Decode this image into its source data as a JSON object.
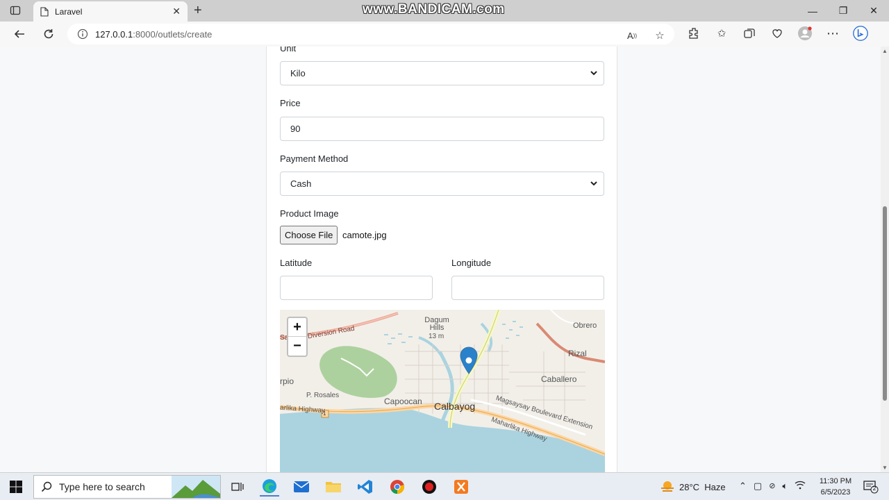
{
  "browser": {
    "tab_title": "Laravel",
    "url_host": "127.0.0.1",
    "url_path": ":8000/outlets/create",
    "watermark": "www.BANDICAM.com"
  },
  "form": {
    "unit_label": "Unit",
    "unit_value": "Kilo",
    "price_label": "Price",
    "price_value": "90",
    "payment_label": "Payment Method",
    "payment_value": "Cash",
    "image_label": "Product Image",
    "choose_file_label": "Choose File",
    "file_name": "camote.jpg",
    "latitude_label": "Latitude",
    "latitude_value": "",
    "longitude_label": "Longitude",
    "longitude_value": ""
  },
  "map": {
    "zoom_in": "+",
    "zoom_out": "−",
    "labels": {
      "dagum_hills": "Dagum\nHills",
      "elev": "13 m",
      "obrero": "Obrero",
      "rizal": "Rizal",
      "caballero": "Caballero",
      "rpio": "rpio",
      "rosales": "P. Rosales",
      "capoocan": "Capoocan",
      "calbayog": "Calbayog",
      "maharlika_w": "arlika Highway",
      "maharlika_e": "Maharlika Highway",
      "magsaysay": "Magsaysay Boulevard Extension",
      "diversion": "garita Diversion Road",
      "sa": "Sa",
      "route": "1"
    },
    "colors": {
      "water": "#aad3df",
      "park": "#add19e",
      "land": "#f2efe9",
      "marker": "#2a81cb"
    }
  },
  "taskbar": {
    "search_placeholder": "Type here to search",
    "weather": "28°C  Haze",
    "time": "11:30 PM",
    "date": "6/5/2023",
    "notif_count": "2"
  }
}
